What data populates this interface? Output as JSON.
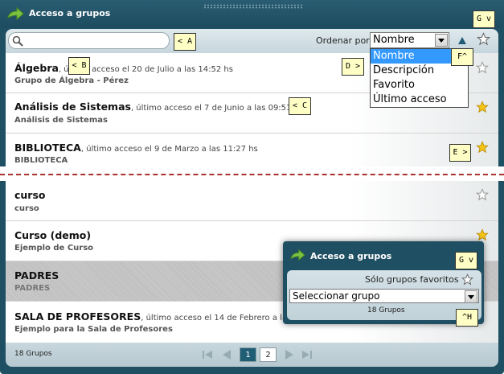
{
  "window": {
    "title": "Acceso a grupos"
  },
  "search": {
    "placeholder": ""
  },
  "order": {
    "label": "Ordenar por:",
    "selected": "Nombre",
    "options": [
      "Nombre",
      "Descripción",
      "Favorito",
      "Último acceso"
    ]
  },
  "groups": [
    {
      "name": "Álgebra",
      "access": ", último acceso el 20 de Julio a las 14:52 hs",
      "sub": "Grupo de Álgebra - Pérez",
      "favorite": false
    },
    {
      "name": "Análisis de Sistemas",
      "access": ", último acceso el 7 de Junio a las 09:51 hs",
      "sub": "Análisis de Sistemas",
      "favorite": true
    },
    {
      "name": "BIBLIOTECA",
      "access": ", último acceso el 9 de Marzo a las 11:27 hs",
      "sub": "BIBLIOTECA",
      "favorite": true
    },
    {
      "name": "curso",
      "access": "",
      "sub": "curso",
      "favorite": false
    },
    {
      "name": "Curso (demo)",
      "access": "",
      "sub": "Ejemplo de Curso",
      "favorite": true
    },
    {
      "name": "PADRES",
      "access": "",
      "sub": "PADRES",
      "favorite": false
    },
    {
      "name": "SALA DE PROFESORES",
      "access": ", último acceso el 14 de Febrero a las 1",
      "sub": "Ejemplo para la Sala de Profesores",
      "favorite": false
    }
  ],
  "footer": {
    "count": "18 Grupos",
    "pages": [
      "1",
      "2"
    ]
  },
  "widget": {
    "title": "Acceso a grupos",
    "fav_label": "Sólo grupos favoritos",
    "select_value": "Seleccionar grupo",
    "count": "18 Grupos"
  },
  "callouts": {
    "a": "< A",
    "b": "< B",
    "c": "< C",
    "d": "D >",
    "e": "E >",
    "f": "F^",
    "g1": "G v",
    "g2": "G v",
    "h": "^H"
  },
  "colors": {
    "frame": "#1f4f62",
    "star_active": "#f5c518",
    "highlight": "#3399ff"
  }
}
